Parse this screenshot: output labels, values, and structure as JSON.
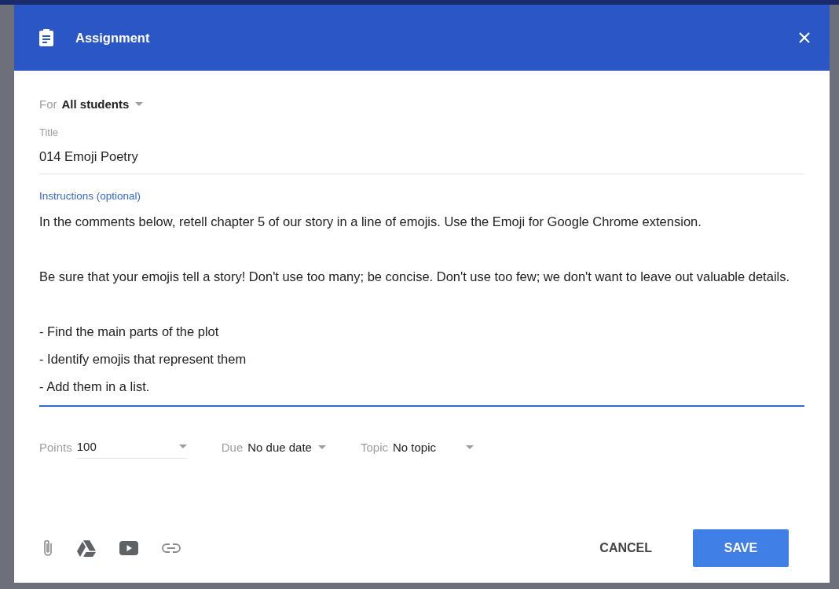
{
  "window": {
    "title": "Assignment"
  },
  "for": {
    "label": "For",
    "value": "All students"
  },
  "title_field": {
    "label": "Title",
    "value": "014 Emoji Poetry"
  },
  "instructions": {
    "label": "Instructions (optional)",
    "focused": true,
    "paragraphs": [
      {
        "lines": [
          "In the comments below, retell chapter 5 of our story in a line of emojis. Use the Emoji for Google Chrome extension."
        ]
      },
      {
        "lines": [
          "Be sure that your emojis tell a story! Don't use too many; be concise. Don't use too few; we don't want to leave out valuable details."
        ]
      },
      {
        "lines": [
          "- Find the main parts of the plot",
          "- Identify emojis that represent them",
          "- Add them in a list."
        ]
      }
    ]
  },
  "points": {
    "label": "Points",
    "value": "100"
  },
  "due": {
    "label": "Due",
    "value": "No due date"
  },
  "topic": {
    "label": "Topic",
    "value": "No topic"
  },
  "attachments": [
    {
      "kind": "file"
    },
    {
      "kind": "drive"
    },
    {
      "kind": "youtube"
    },
    {
      "kind": "link"
    }
  ],
  "buttons": [
    {
      "label": "CANCEL",
      "kind": "text"
    },
    {
      "label": "SAVE",
      "kind": "primary"
    }
  ]
}
